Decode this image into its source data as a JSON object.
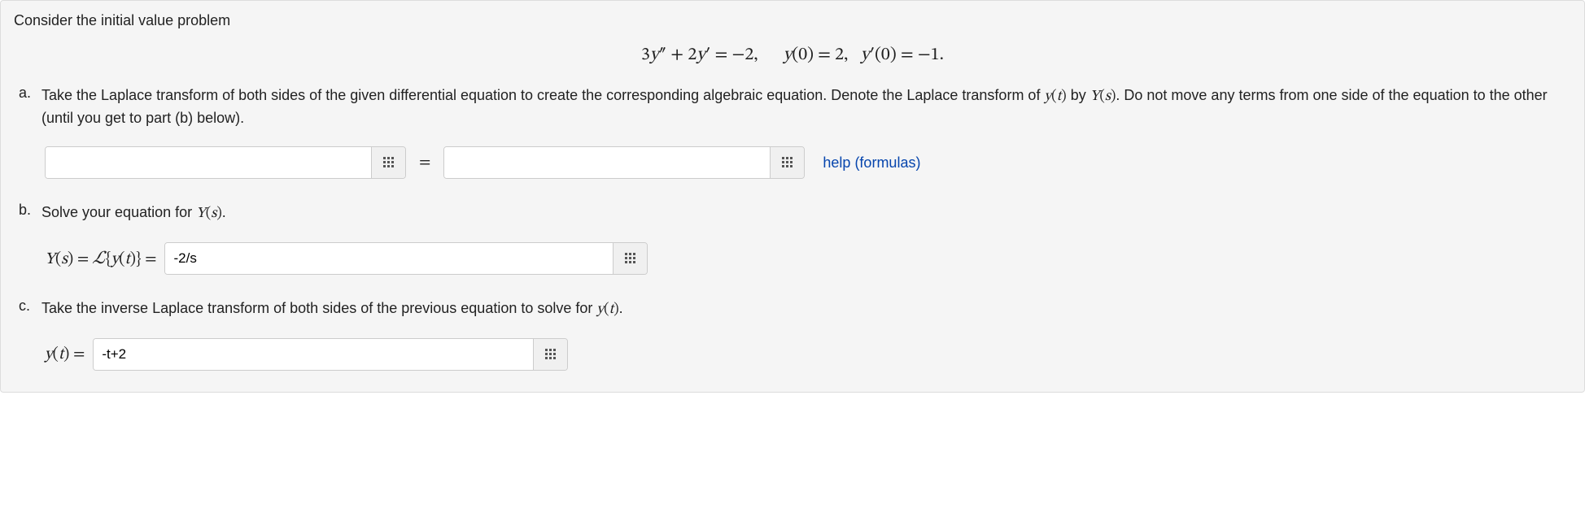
{
  "intro": "Consider the initial value problem",
  "equation_display": "3y″ + 2y′ = −2,  y(0) = 2, y′(0) = −1.",
  "parts": {
    "a": {
      "marker": "a.",
      "text_before": "Take the Laplace transform of both sides of the given differential equation to create the corresponding algebraic equation. Denote the Laplace transform of ",
      "math1": "y(t)",
      "text_mid1": " by ",
      "math2": "Y(s)",
      "text_mid2": ". Do not move any terms from one side of the equation to the other (until you get to part (b) below).",
      "lhs_value": "",
      "equals": "=",
      "rhs_value": "",
      "help": "help (formulas)"
    },
    "b": {
      "marker": "b.",
      "text_before": "Solve your equation for ",
      "math1": "Y(s)",
      "text_after": ".",
      "prefix_Y": "Y(s) = ",
      "prefix_L": "ℒ{y(t)} = ",
      "value": "-2/s"
    },
    "c": {
      "marker": "c.",
      "text_before": "Take the inverse Laplace transform of both sides of the previous equation to solve for ",
      "math1": "y(t)",
      "text_after": ".",
      "prefix": "y(t) = ",
      "value": "-t+2"
    }
  }
}
